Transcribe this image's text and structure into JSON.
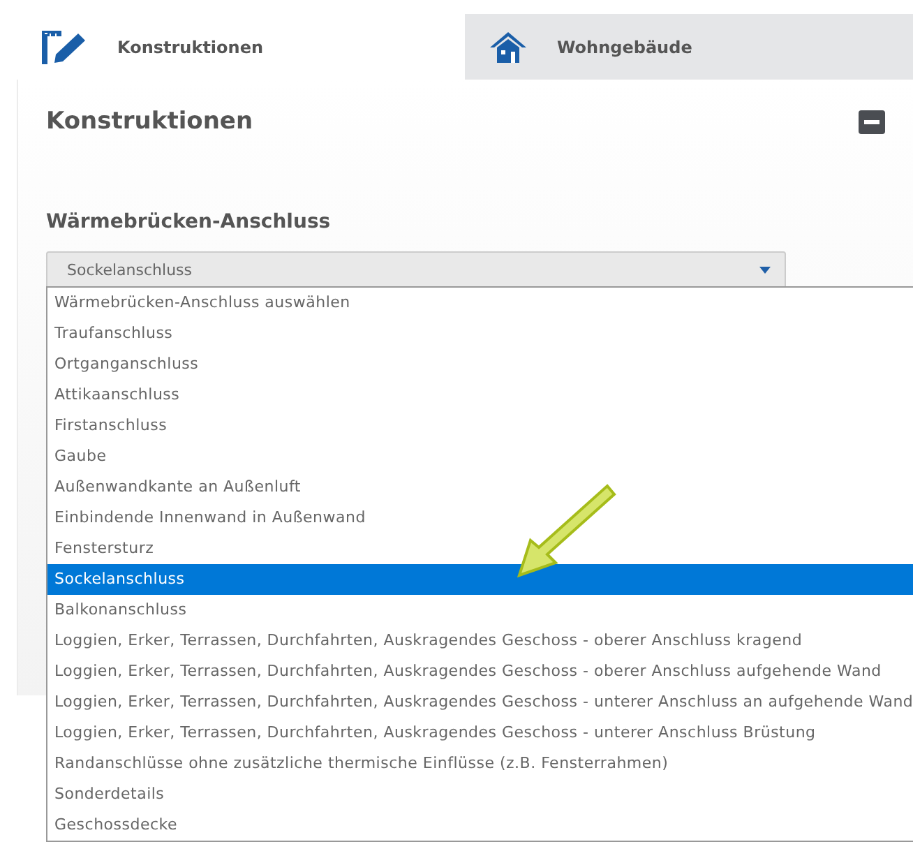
{
  "tabs": [
    {
      "label": "Konstruktionen",
      "selected": true
    },
    {
      "label": "Wohngebäude",
      "selected": false
    }
  ],
  "panel": {
    "title": "Konstruktionen",
    "collapsed": false
  },
  "field": {
    "label": "Wärmebrücken-Anschluss",
    "value": "Sockelanschluss",
    "expanded": true,
    "options": [
      {
        "label": "Wärmebrücken-Anschluss auswählen",
        "selected": false
      },
      {
        "label": "Traufanschluss",
        "selected": false
      },
      {
        "label": "Ortganganschluss",
        "selected": false
      },
      {
        "label": "Attikaanschluss",
        "selected": false
      },
      {
        "label": "Firstanschluss",
        "selected": false
      },
      {
        "label": "Gaube",
        "selected": false
      },
      {
        "label": "Außenwandkante an Außenluft",
        "selected": false
      },
      {
        "label": "Einbindende Innenwand in Außenwand",
        "selected": false
      },
      {
        "label": "Fenstersturz",
        "selected": false
      },
      {
        "label": "Sockelanschluss",
        "selected": true
      },
      {
        "label": "Balkonanschluss",
        "selected": false
      },
      {
        "label": "Loggien, Erker, Terrassen, Durchfahrten, Auskragendes Geschoss - oberer Anschluss kragend",
        "selected": false
      },
      {
        "label": "Loggien, Erker, Terrassen, Durchfahrten, Auskragendes Geschoss - oberer Anschluss aufgehende Wand",
        "selected": false
      },
      {
        "label": "Loggien, Erker, Terrassen, Durchfahrten, Auskragendes Geschoss - unterer Anschluss an aufgehende Wand",
        "selected": false
      },
      {
        "label": "Loggien, Erker, Terrassen, Durchfahrten, Auskragendes Geschoss - unterer Anschluss Brüstung",
        "selected": false
      },
      {
        "label": "Randanschlüsse ohne zusätzliche thermische Einflüsse (z.B. Fensterrahmen)",
        "selected": false
      },
      {
        "label": "Sonderdetails",
        "selected": false
      },
      {
        "label": "Geschossdecke",
        "selected": false
      }
    ]
  }
}
